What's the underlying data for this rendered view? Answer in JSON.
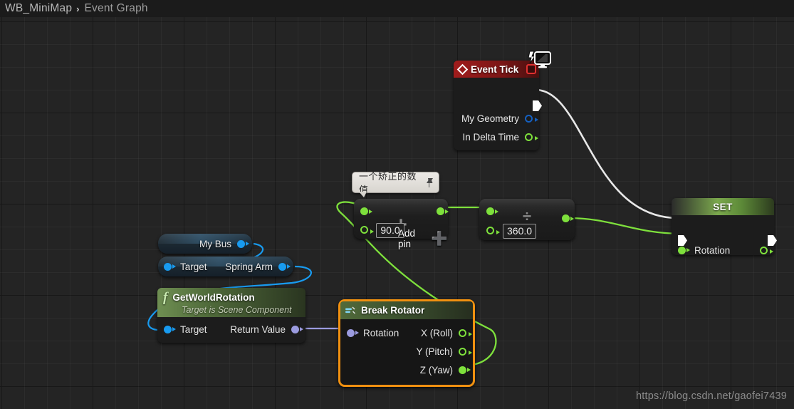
{
  "breadcrumb": {
    "root": "WB_MiniMap",
    "separator": "›",
    "current": "Event Graph"
  },
  "colors": {
    "exec_wire": "#e8e8e8",
    "float_wire": "#7ee03c",
    "object_wire": "#189bf0",
    "rotator_wire": "#9b9bdf",
    "selection": "#f09010",
    "event_header": "#8b1818",
    "function_header": "#5d8a38",
    "variable_header": "#1c6fa8",
    "canvas_bg": "#242424"
  },
  "nodes": {
    "event_tick": {
      "title": "Event Tick",
      "icon": "event-diamond-icon",
      "badge_icon": "monitor-lightning-icon",
      "delegate_icon": "red-square-pin",
      "outputs": [
        {
          "label": "My Geometry",
          "pin": "hollow",
          "color": "c-dblue"
        },
        {
          "label": "In Delta Time",
          "pin": "hollow",
          "color": "c-green"
        }
      ]
    },
    "add": {
      "operator": "+",
      "add_pin_label": "Add pin",
      "add_pin_glyph": "➕",
      "value": "90.0",
      "tooltip": {
        "text": "一个矫正的数值",
        "icon": "pushpin-icon"
      }
    },
    "divide": {
      "operator": "÷",
      "value": "360.0"
    },
    "set": {
      "title": "SET",
      "input_label": "Rotation"
    },
    "break_rotator": {
      "title": "Break Rotator",
      "icon": "break-struct-icon",
      "selected": true,
      "input": {
        "label": "Rotation",
        "pin": "solid",
        "color": "c-purple"
      },
      "outputs": [
        {
          "label": "X (Roll)",
          "pin": "hollow",
          "color": "c-green"
        },
        {
          "label": "Y (Pitch)",
          "pin": "hollow",
          "color": "c-green"
        },
        {
          "label": "Z (Yaw)",
          "pin": "solid",
          "color": "c-green"
        }
      ]
    },
    "get_world_rotation": {
      "title": "GetWorldRotation",
      "subtitle": "Target is Scene Component",
      "icon": "function-f-icon",
      "input_label": "Target",
      "output_label": "Return Value"
    },
    "my_bus": {
      "label": "My Bus"
    },
    "spring_arm": {
      "input_label": "Target",
      "output_label": "Spring Arm"
    }
  },
  "watermark": "https://blog.csdn.net/gaofei7439"
}
